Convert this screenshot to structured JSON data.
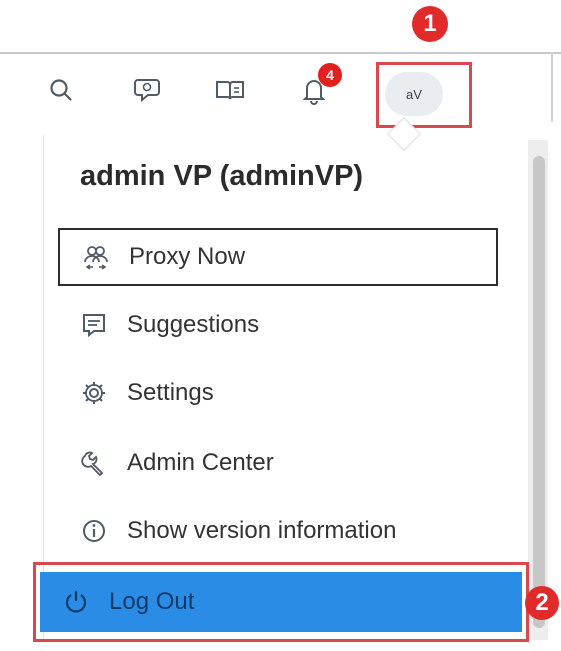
{
  "toolbar": {
    "icons": [
      "search-icon",
      "chat-icon",
      "book-icon",
      "bell-icon"
    ],
    "notification_count": "4",
    "avatar_initials": "aV"
  },
  "annotations": {
    "step1": "1",
    "step2": "2"
  },
  "user_menu": {
    "user_name": "admin VP (adminVP)",
    "items": [
      {
        "label": "Proxy Now",
        "icon": "proxy-icon"
      },
      {
        "label": "Suggestions",
        "icon": "suggestions-icon"
      },
      {
        "label": "Settings",
        "icon": "gear-icon"
      },
      {
        "label": "Admin Center",
        "icon": "wrench-icon"
      },
      {
        "label": "Show version information",
        "icon": "info-icon"
      },
      {
        "label": "Log Out",
        "icon": "power-icon"
      }
    ]
  },
  "colors": {
    "accent": "#2a8ce4",
    "highlight": "#d9484c",
    "badge": "#e0201e"
  }
}
